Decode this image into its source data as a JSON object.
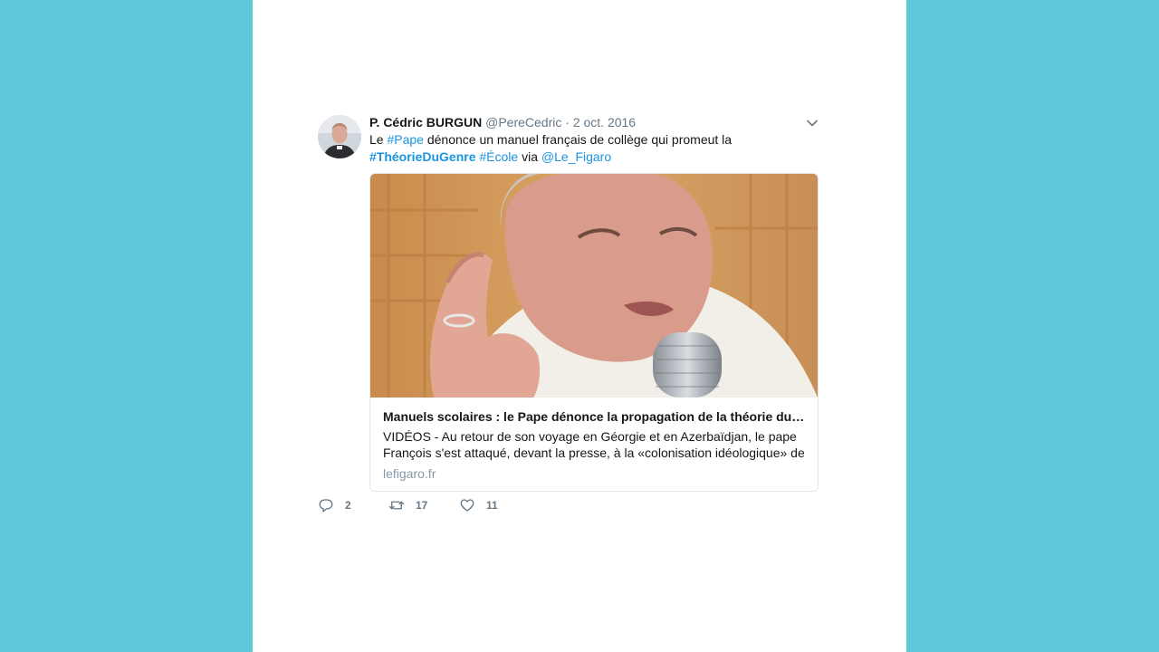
{
  "tweet": {
    "author_name": "P. Cédric BURGUN",
    "author_handle": "@PereCedric",
    "separator": "·",
    "date": "2 oct. 2016",
    "text": {
      "t1": "Le ",
      "hashtag_pape": "#Pape",
      "t2": " dénonce un manuel français de collège qui promeut la",
      "hashtag_theorie": "#ThéorieDuGenre",
      "t3": " ",
      "hashtag_ecole": "#École",
      "t4": " via ",
      "mention": "@Le_Figaro"
    },
    "card": {
      "title": "Manuels scolaires : le Pape dénonce la propagation de la théorie du g…",
      "description": "VIDÉOS - Au retour de son voyage en Géorgie et en Azerbaïdjan, le pape François s'est attaqué, devant la presse, à la «colonisation idéologique» de",
      "domain": "lefigaro.fr"
    },
    "actions": {
      "replies": "2",
      "retweets": "17",
      "likes": "11"
    }
  },
  "colors": {
    "background": "#5ec8da",
    "link": "#1b95e0",
    "muted": "#657786"
  }
}
